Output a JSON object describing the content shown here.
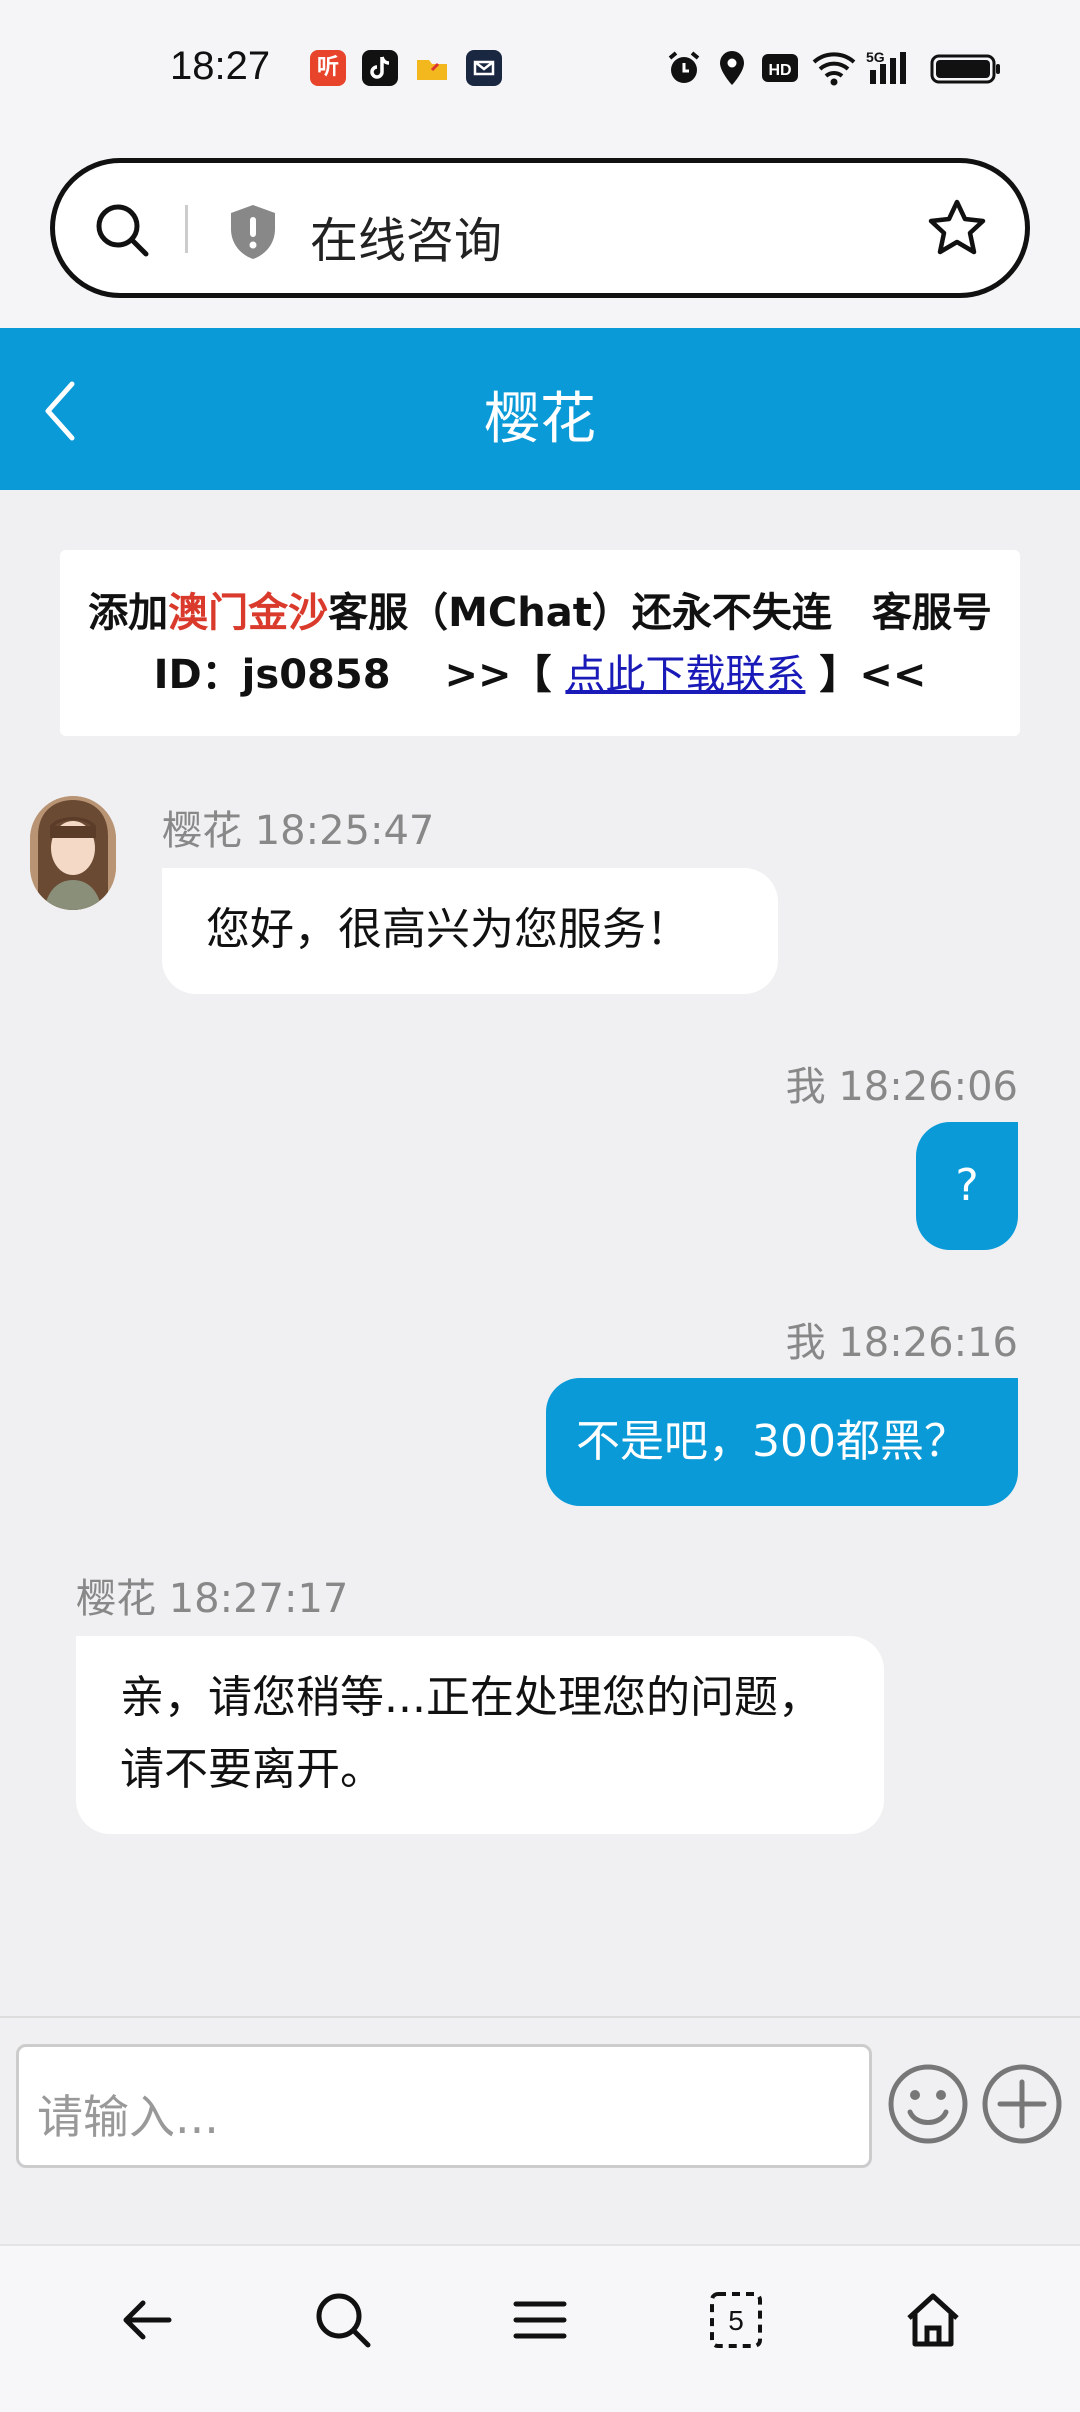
{
  "status_bar": {
    "time": "18:27",
    "apps": [
      "听",
      "douyin-icon",
      "folder-icon",
      "mail-icon"
    ],
    "network": "5G"
  },
  "address_bar": {
    "text": "在线咨询"
  },
  "header": {
    "title": "樱花"
  },
  "notice": {
    "part1": "添加",
    "brand": "澳门金沙",
    "part2": "客服（MChat）还永不失连　客服号ID：js0858　 >>【 ",
    "link": "点此下载联系",
    "part3": " 】<<"
  },
  "messages": [
    {
      "sender": "樱花",
      "time": "18:25:47",
      "text": "您好，很高兴为您服务！"
    },
    {
      "sender": "我",
      "time": "18:26:06",
      "text": "?"
    },
    {
      "sender": "我",
      "time": "18:26:16",
      "text": "不是吧，300都黑？"
    },
    {
      "sender": "樱花",
      "time": "18:27:17",
      "text": "亲，请您稍等...正在处理您的问题，请不要离开。"
    }
  ],
  "input": {
    "placeholder": "请输入..."
  },
  "colors": {
    "accent": "#0a9ad8",
    "brand_red": "#d93a2c"
  }
}
